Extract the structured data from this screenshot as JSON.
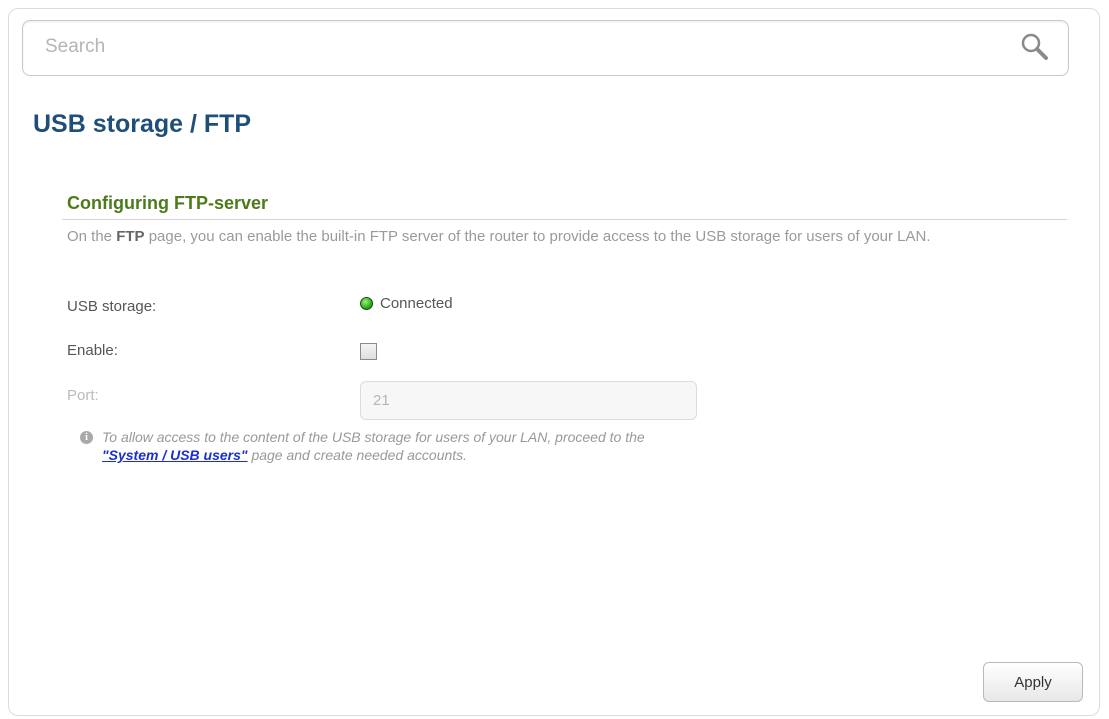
{
  "search": {
    "placeholder": "Search",
    "icon": "search-icon"
  },
  "page": {
    "title": "USB storage /  FTP"
  },
  "section": {
    "title": "Configuring FTP-server",
    "desc_prefix": "On the ",
    "desc_bold": "FTP",
    "desc_suffix": " page, you can enable the built-in FTP server of the router to provide access to the USB storage for users of your LAN."
  },
  "fields": {
    "usb_label": "USB storage:",
    "usb_status": "Connected",
    "usb_status_color": "#2fae1a",
    "enable_label": "Enable:",
    "enable_checked": false,
    "port_label": "Port:",
    "port_value": "21"
  },
  "note": {
    "icon": "info-icon",
    "text_before": "To allow access to the content of the USB storage for users of your LAN, proceed to the",
    "link_text": "\"System / USB users\"",
    "text_after": " page and create needed accounts."
  },
  "buttons": {
    "apply_label": "Apply"
  },
  "colors": {
    "title": "#1f4e79",
    "section": "#4d7a1b",
    "link": "#1a2fd1"
  }
}
